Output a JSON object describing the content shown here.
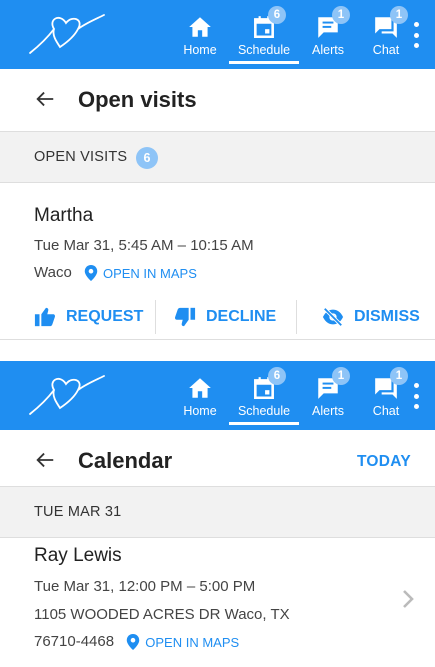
{
  "nav": {
    "items": [
      {
        "label": "Home",
        "icon": "home-icon",
        "badge": ""
      },
      {
        "label": "Schedule",
        "icon": "calendar-icon",
        "badge": "6"
      },
      {
        "label": "Alerts",
        "icon": "message-icon",
        "badge": "1"
      },
      {
        "label": "Chat",
        "icon": "chat-icon",
        "badge": "1"
      }
    ],
    "active": "Schedule"
  },
  "open_visits_screen": {
    "title": "Open visits",
    "section_label": "OPEN VISITS",
    "section_count": "6",
    "visit": {
      "client": "Martha",
      "time": "Tue Mar 31, 5:45 AM – 10:15 AM",
      "location": "Waco",
      "maps_label": "OPEN IN MAPS"
    },
    "actions": {
      "request": "REQUEST",
      "decline": "DECLINE",
      "dismiss": "DISMISS"
    }
  },
  "calendar_screen": {
    "title": "Calendar",
    "today_label": "TODAY",
    "section_label": "TUE MAR 31",
    "visit": {
      "client": "Ray Lewis",
      "time": "Tue Mar 31, 12:00 PM – 5:00 PM",
      "address_line1": "1105 WOODED ACRES DR Waco, TX",
      "address_line2": "76710-4468",
      "maps_label": "OPEN IN MAPS"
    }
  },
  "colors": {
    "brand": "#1f8ef1",
    "badge": "#8ec4f7",
    "section_bg": "#f2f2f2"
  }
}
